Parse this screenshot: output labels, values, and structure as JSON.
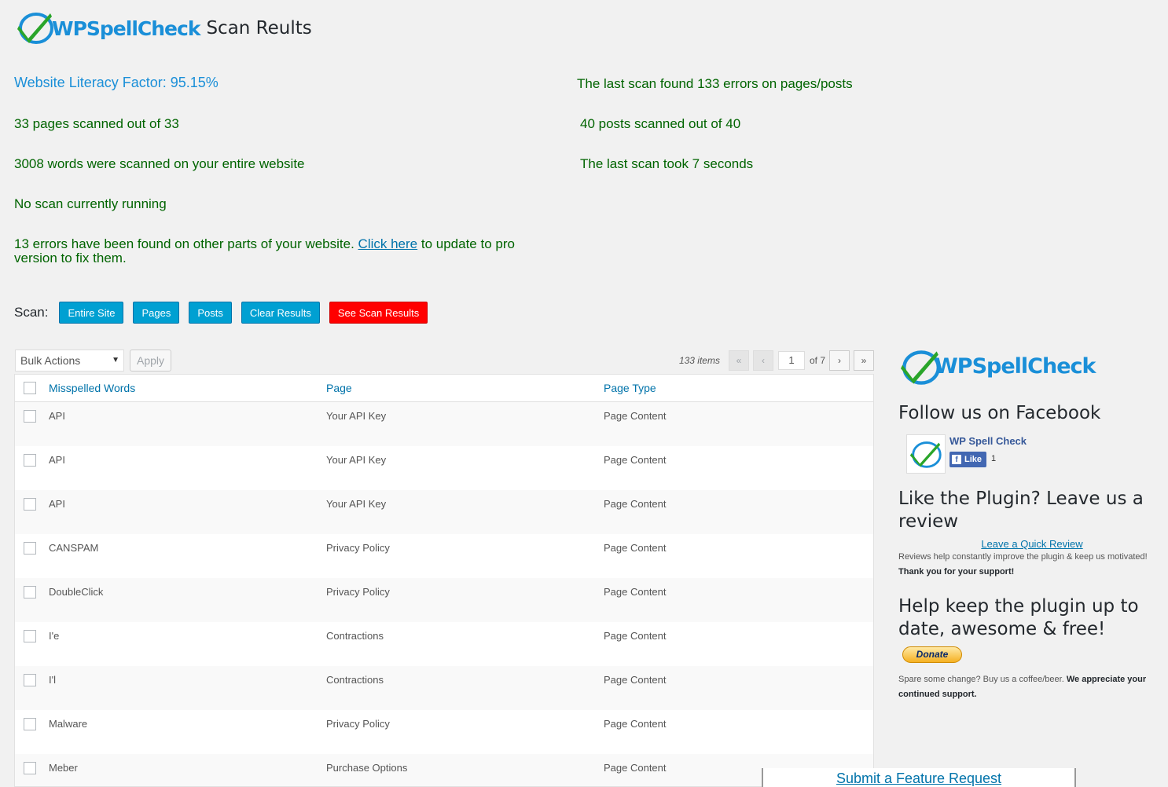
{
  "header": {
    "logo_text": "WPSpellCheck",
    "title": "Scan Reults"
  },
  "stats": {
    "literacy": "Website Literacy Factor: 95.15%",
    "last_scan_errors": "The last scan found 133 errors on pages/posts",
    "pages_scanned": "33 pages scanned out of 33",
    "posts_scanned": "40 posts scanned out of 40",
    "words_scanned": "3008 words were scanned on your entire website",
    "scan_time": "The last scan took 7 seconds",
    "scan_status": "No scan currently running",
    "other_errors_pre": "13 errors have been found on other parts of your website. ",
    "other_errors_link": "Click here",
    "other_errors_post": " to update to pro version to fix them."
  },
  "scan": {
    "label": "Scan:",
    "buttons": [
      "Entire Site",
      "Pages",
      "Posts",
      "Clear Results",
      "See Scan Results"
    ]
  },
  "tablenav": {
    "bulk_actions": "Bulk Actions",
    "apply": "Apply",
    "items": "133 items",
    "first": "«",
    "prev": "‹",
    "current_page": "1",
    "of_pages": "of 7",
    "next": "›",
    "last": "»"
  },
  "table": {
    "headers": [
      "Misspelled Words",
      "Page",
      "Page Type"
    ],
    "rows": [
      {
        "word": "API",
        "page": "Your API Key",
        "type": "Page Content"
      },
      {
        "word": "API",
        "page": "Your API Key",
        "type": "Page Content"
      },
      {
        "word": "API",
        "page": "Your API Key",
        "type": "Page Content"
      },
      {
        "word": "CANSPAM",
        "page": "Privacy Policy",
        "type": "Page Content"
      },
      {
        "word": "DoubleClick",
        "page": "Privacy Policy",
        "type": "Page Content"
      },
      {
        "word": "I'e",
        "page": "Contractions",
        "type": "Page Content"
      },
      {
        "word": "I'l",
        "page": "Contractions",
        "type": "Page Content"
      },
      {
        "word": "Malware",
        "page": "Privacy Policy",
        "type": "Page Content"
      },
      {
        "word": "Meber",
        "page": "Purchase Options",
        "type": "Page Content"
      }
    ]
  },
  "sidebar": {
    "logo_text": "WPSpellCheck",
    "follow_heading": "Follow us on Facebook",
    "fb_name": "WP Spell Check",
    "fb_like": "Like",
    "fb_count": "1",
    "review_heading": "Like the Plugin? Leave us a review",
    "review_link": "Leave a Quick Review",
    "review_text": "Reviews help constantly improve the plugin & keep us motivated!",
    "review_thanks": "Thank you for your support!",
    "donate_heading": "Help keep the plugin up to date, awesome & free!",
    "donate_button": "Donate",
    "donate_text": "Spare some change? Buy us a coffee/beer. ",
    "donate_bold": "We appreciate your continued support."
  },
  "feature_request": "Submit a Feature Request",
  "colors": {
    "accent_blue": "#1a8fd8",
    "stat_green": "#006400",
    "wp_button": "#00a0d2",
    "danger_button": "#ff0000",
    "logo_check": "#2aa52a"
  }
}
